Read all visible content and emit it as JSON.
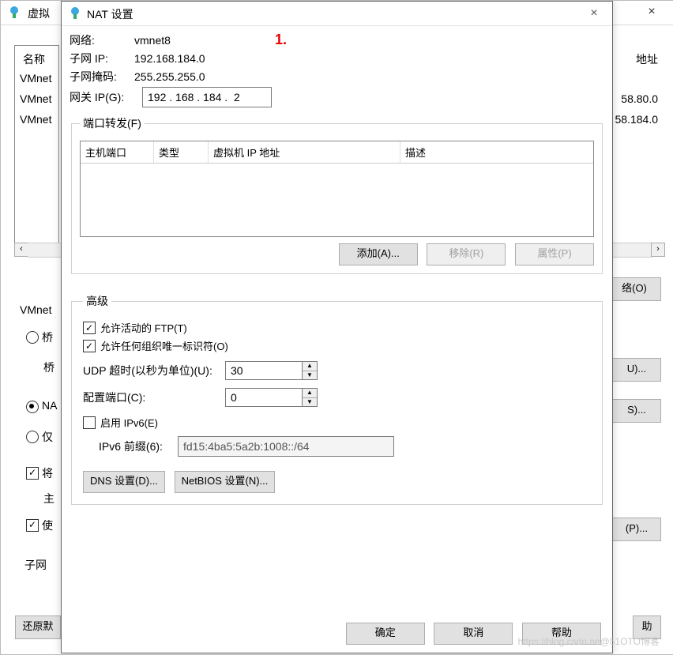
{
  "bg": {
    "title": "虚拟",
    "col_name": "名称",
    "col_addr": "地址",
    "rows": [
      "VMnet",
      "VMnet",
      "VMnet"
    ],
    "rownums": [
      "",
      "58.80.0",
      "58.184.0"
    ],
    "btn_network": "络(O)",
    "fs_label": "VMnet",
    "radio_bridge": "桥",
    "bridge_sub": "桥",
    "radio_nat": "NA",
    "radio_host": "仅",
    "chk_dhcp": "将",
    "dhcp_sub": "主",
    "chk_connect": "使",
    "subnet_label": "子网",
    "btn_u": "U)...",
    "btn_s": "S)...",
    "btn_p": "(P)...",
    "restore": "还原默",
    "help_r": "助"
  },
  "dlg": {
    "title": "NAT 设置",
    "annotation": "1.",
    "network_label": "网络:",
    "network_value": "vmnet8",
    "subnetip_label": "子网 IP:",
    "subnetip_value": "192.168.184.0",
    "mask_label": "子网掩码:",
    "mask_value": "255.255.255.0",
    "gateway_label": "网关 IP(G):",
    "gateway_value": "192 . 168 . 184 .  2",
    "pf_legend": "端口转发(F)",
    "pf_headers": {
      "hostport": "主机端口",
      "type": "类型",
      "vmip": "虚拟机 IP 地址",
      "desc": "描述"
    },
    "pf_add": "添加(A)...",
    "pf_remove": "移除(R)",
    "pf_props": "属性(P)",
    "adv_legend": "高级",
    "chk_ftp": "允许活动的 FTP(T)",
    "chk_oui": "允许任何组织唯一标识符(O)",
    "udp_label": "UDP 超时(以秒为单位)(U):",
    "udp_value": "30",
    "port_label": "配置端口(C):",
    "port_value": "0",
    "chk_ipv6": "启用 IPv6(E)",
    "ipv6_prefix_label": "IPv6 前缀(6):",
    "ipv6_prefix_value": "fd15:4ba5:5a2b:1008::/64",
    "btn_dns": "DNS 设置(D)...",
    "btn_netbios": "NetBIOS 设置(N)...",
    "ok": "确定",
    "cancel": "取消",
    "help": "帮助"
  },
  "watermark": "https://blog.csdn.ne@51OTO博客"
}
